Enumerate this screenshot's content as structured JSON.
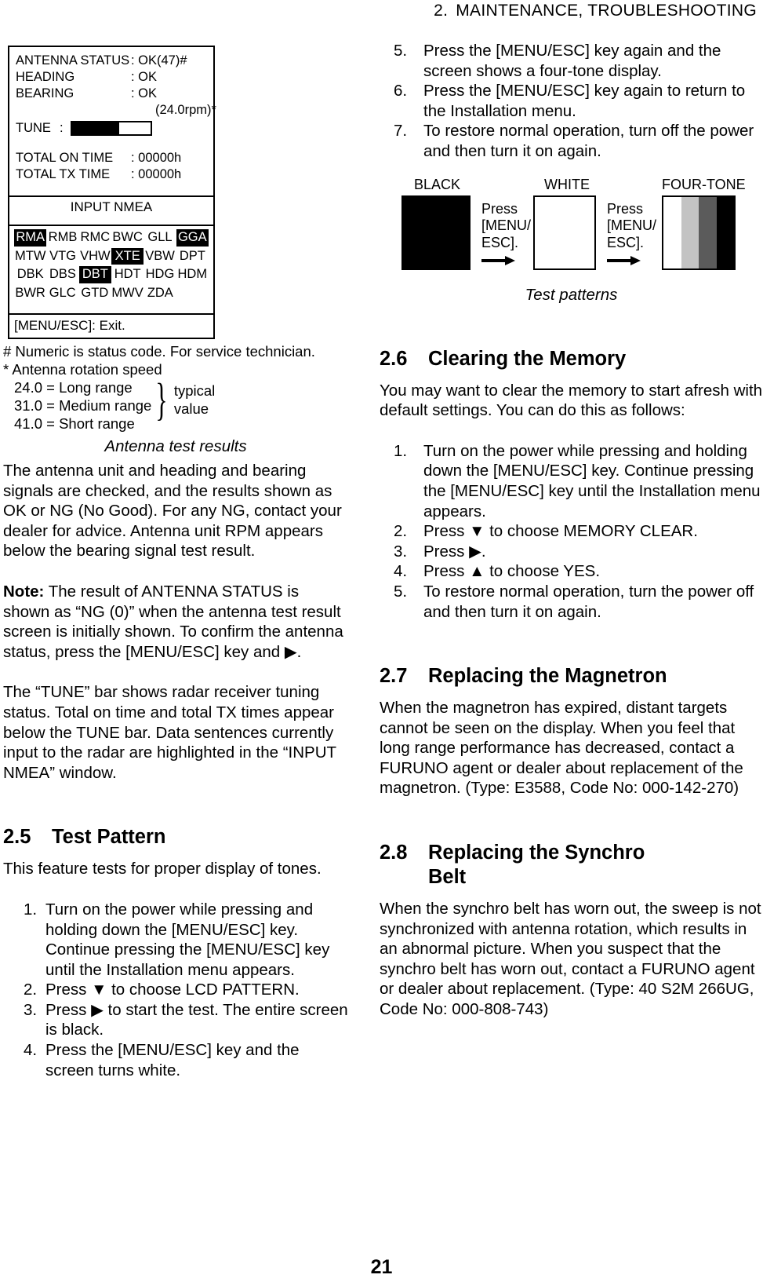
{
  "header": {
    "chapter_number": "2.",
    "chapter_title": "MAINTENANCE,  TROUBLESHOOTING"
  },
  "page_number": "21",
  "antenna_screen": {
    "rows": [
      {
        "label": "ANTENNA STATUS",
        "value": ": OK(47)#"
      },
      {
        "label": "HEADING",
        "value": ": OK"
      },
      {
        "label": "BEARING",
        "value": ": OK"
      }
    ],
    "rpm_value": "(24.0rpm)*",
    "tune_label": "TUNE",
    "tune_colon": ":",
    "tune_fill_percent": "60",
    "times": [
      {
        "label": "TOTAL ON TIME",
        "value": ": 00000h"
      },
      {
        "label": "TOTAL TX TIME",
        "value": ": 00000h"
      }
    ],
    "nmea_title": "INPUT NMEA",
    "nmea_rows": [
      [
        {
          "text": "RMA",
          "highlighted": true
        },
        {
          "text": "RMB",
          "highlighted": false
        },
        {
          "text": "RMC",
          "highlighted": false
        },
        {
          "text": "BWC",
          "highlighted": false
        },
        {
          "text": "GLL",
          "highlighted": false
        },
        {
          "text": "GGA",
          "highlighted": true
        }
      ],
      [
        {
          "text": "MTW",
          "highlighted": false
        },
        {
          "text": "VTG",
          "highlighted": false
        },
        {
          "text": "VHW",
          "highlighted": false
        },
        {
          "text": "XTE",
          "highlighted": true
        },
        {
          "text": "VBW",
          "highlighted": false
        },
        {
          "text": "DPT",
          "highlighted": false
        }
      ],
      [
        {
          "text": "DBK",
          "highlighted": false
        },
        {
          "text": "DBS",
          "highlighted": false
        },
        {
          "text": "DBT",
          "highlighted": true
        },
        {
          "text": "HDT",
          "highlighted": false
        },
        {
          "text": "HDG",
          "highlighted": false
        },
        {
          "text": "HDM",
          "highlighted": false
        }
      ],
      [
        {
          "text": "BWR",
          "highlighted": false
        },
        {
          "text": "GLC",
          "highlighted": false
        },
        {
          "text": "GTD",
          "highlighted": false
        },
        {
          "text": "MWV",
          "highlighted": false
        },
        {
          "text": "ZDA",
          "highlighted": false
        },
        {
          "text": "",
          "highlighted": false
        }
      ]
    ],
    "exit_hint": "[MENU/ESC]: Exit.",
    "note_hash": "# Numeric is status code.  For service technician.",
    "note_star": "* Antenna rotation speed",
    "speed_lines": [
      "24.0 = Long range",
      "31.0 = Medium range",
      "41.0 = Short range"
    ],
    "brace_label_line1": "typical",
    "brace_label_line2": "value",
    "caption": "Antenna test results"
  },
  "left_column": {
    "para_1": "The antenna unit and heading and bearing signals are checked, and the results shown as OK or NG (No Good). For any NG, contact your dealer for advice. Antenna unit RPM appears below the bearing signal test result.",
    "note_lead": "Note:",
    "note_body": " The result of ANTENNA STATUS is shown as “NG (0)” when the antenna test result screen is initially shown. To confirm the antenna status, press the [MENU/ESC] key and ▶.",
    "para_2": "The “TUNE” bar shows radar receiver tuning status. Total on time and total TX times appear below the TUNE bar. Data sentences currently input to the radar are highlighted in the “INPUT NMEA” window.",
    "section_2_5": {
      "number": "2.5",
      "title": "Test Pattern",
      "intro": "This feature tests for proper display of tones.",
      "steps": [
        {
          "marker": "1.",
          "text": "Turn on the power while pressing and holding down the [MENU/ESC] key. Continue pressing the [MENU/ESC] key until the Installation menu appears."
        },
        {
          "marker": "2.",
          "text": "Press ▼ to choose LCD PATTERN."
        },
        {
          "marker": "3.",
          "text": "Press ▶ to start the test. The entire screen is black."
        },
        {
          "marker": "4.",
          "text": "Press the [MENU/ESC] key and the screen turns white."
        }
      ]
    }
  },
  "right_column": {
    "steps_continued": [
      {
        "marker": "5.",
        "text": "Press the [MENU/ESC] key again and the screen shows a four-tone display."
      },
      {
        "marker": "6.",
        "text": "Press the [MENU/ESC] key again to return to the Installation menu."
      },
      {
        "marker": "7.",
        "text": "To restore normal operation, turn off the power and then turn it on again."
      }
    ],
    "test_pattern_figure": {
      "label_black": "BLACK",
      "label_white": "WHITE",
      "label_four_tone": "FOUR-TONE",
      "press_1_line1": "Press",
      "press_1_line2": "[MENU/",
      "press_1_line3": "ESC].",
      "press_2_line1": "Press",
      "press_2_line2": "[MENU/",
      "press_2_line3": "ESC].",
      "tone_colors": [
        "#ffffff",
        "#c3c3c3",
        "#5b5b5b",
        "#000000"
      ],
      "caption": "Test patterns"
    },
    "section_2_6": {
      "number": "2.6",
      "title": "Clearing the Memory",
      "intro": "You may want to clear the memory to start afresh with default settings. You can do this as follows:",
      "steps": [
        {
          "marker": "1.",
          "text": "Turn on the power while pressing and holding down the [MENU/ESC] key. Continue pressing the [MENU/ESC] key until the Installation menu appears."
        },
        {
          "marker": "2.",
          "text": "Press ▼ to choose MEMORY CLEAR."
        },
        {
          "marker": "3.",
          "text": "Press ▶."
        },
        {
          "marker": "4.",
          "text": "Press ▲ to choose YES."
        },
        {
          "marker": "5.",
          "text": "To restore normal operation, turn the power off and then turn it on again."
        }
      ]
    },
    "section_2_7": {
      "number": "2.7",
      "title": "Replacing the Magnetron",
      "body": "When the magnetron has expired, distant targets cannot be seen on the display. When you feel that long range performance has decreased, contact a FURUNO agent or dealer about replacement of the magnetron. (Type: E3588, Code No: 000-142-270)"
    },
    "section_2_8": {
      "number": "2.8",
      "title_line1": "Replacing the Synchro",
      "title_line2": "Belt",
      "body": "When the synchro belt has worn out, the sweep is not synchronized with antenna rotation, which results in an abnormal picture. When you suspect that the synchro belt has worn out, contact a FURUNO agent or dealer about replacement. (Type: 40 S2M 266UG, Code No: 000-808-743)"
    }
  }
}
